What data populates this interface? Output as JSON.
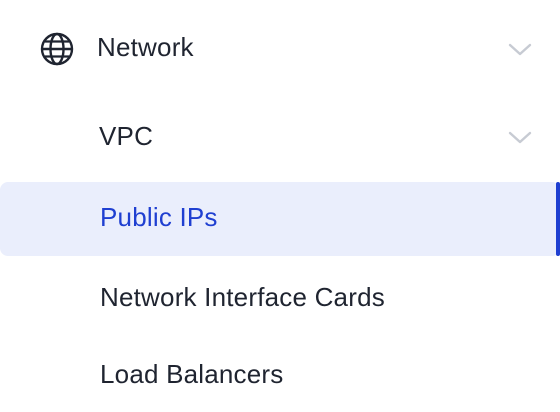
{
  "nav": {
    "network": {
      "label": "Network",
      "icon": "globe-icon",
      "expanded_icon": "chevron-down-icon"
    },
    "vpc": {
      "label": "VPC",
      "expanded_icon": "chevron-down-icon"
    },
    "items": [
      {
        "label": "Public IPs",
        "active": true
      },
      {
        "label": "Network Interface Cards",
        "active": false
      },
      {
        "label": "Load Balancers",
        "active": false
      }
    ]
  },
  "colors": {
    "text": "#1f2430",
    "active_text": "#1f3fd1",
    "active_bg": "#eaeefc",
    "active_bar": "#1f3fd1",
    "chevron": "#c7cbd3"
  }
}
